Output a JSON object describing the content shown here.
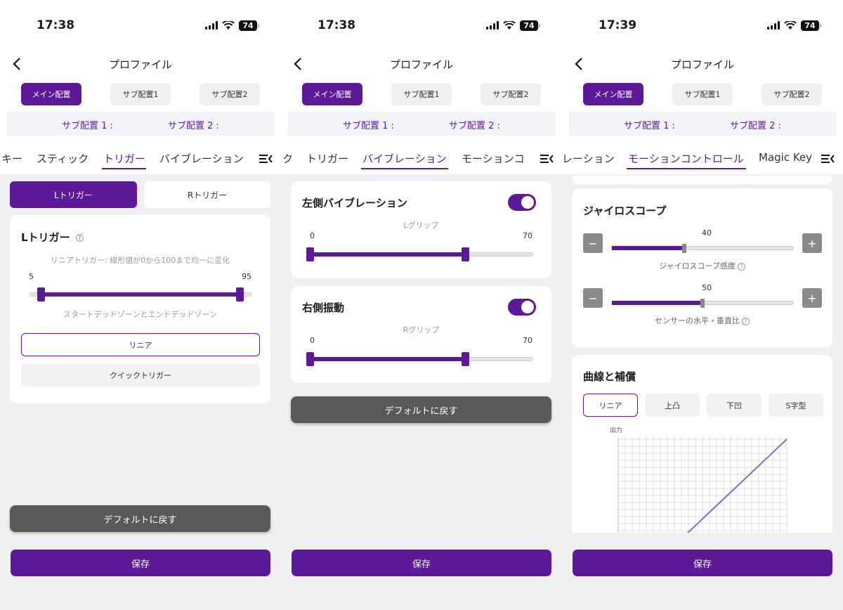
{
  "colors": {
    "accent": "#5c1a99",
    "grey_button": "#595959",
    "background": "#f0f0f0"
  },
  "status": {
    "time_1": "17:38",
    "time_2": "17:38",
    "time_3": "17:39",
    "battery": "74"
  },
  "header": {
    "title": "プロファイル"
  },
  "layout_buttons": [
    "メイン配置",
    "サブ配置1",
    "サブ配置2"
  ],
  "sub_band": {
    "sub1": "サブ配置 1 :",
    "sub2": "サブ配置 2 :"
  },
  "tabs_1": [
    "キー",
    "スティック",
    "トリガー",
    "バイブレーション"
  ],
  "tabs_2": [
    "ク",
    "トリガー",
    "バイブレーション",
    "モーションコ"
  ],
  "tabs_3": [
    "レーション",
    "モーションコントロール",
    "Magic Key"
  ],
  "trigger": {
    "segments": [
      "Lトリガー",
      "Rトリガー"
    ],
    "card_title": "Lトリガー",
    "description": "リニアトリガー: 線形値が0から100まで均一に変化",
    "min_label": "5",
    "max_label": "95",
    "range_start": 5,
    "range_end": 95,
    "caption": "スタートデッドゾーンとエンドデッドゾーン",
    "options": [
      "リニア",
      "クイックトリガー"
    ],
    "default_button": "デフォルトに戻す"
  },
  "vibration": {
    "left_title": "左側バイブレーション",
    "left_caption": "Lグリップ",
    "left_min": "0",
    "left_value": "70",
    "left_fraction": 0.7,
    "right_title": "右側振動",
    "right_caption": "Rグリップ",
    "right_min": "0",
    "right_value": "70",
    "right_fraction": 0.7,
    "default_button": "デフォルトに戻す"
  },
  "motion": {
    "gyro_title": "ジャイロスコープ",
    "gyro_value": "40",
    "gyro_fraction": 0.4,
    "gyro_caption": "ジャイロスコープ感度",
    "ratio_value": "50",
    "ratio_fraction": 0.5,
    "ratio_caption": "センサーの水平・垂直比",
    "curve_title": "曲線と補償",
    "curve_options": [
      "リニア",
      "上凸",
      "下凹",
      "S字型"
    ],
    "graph_ylabel": "出力"
  },
  "save_label": "保存"
}
